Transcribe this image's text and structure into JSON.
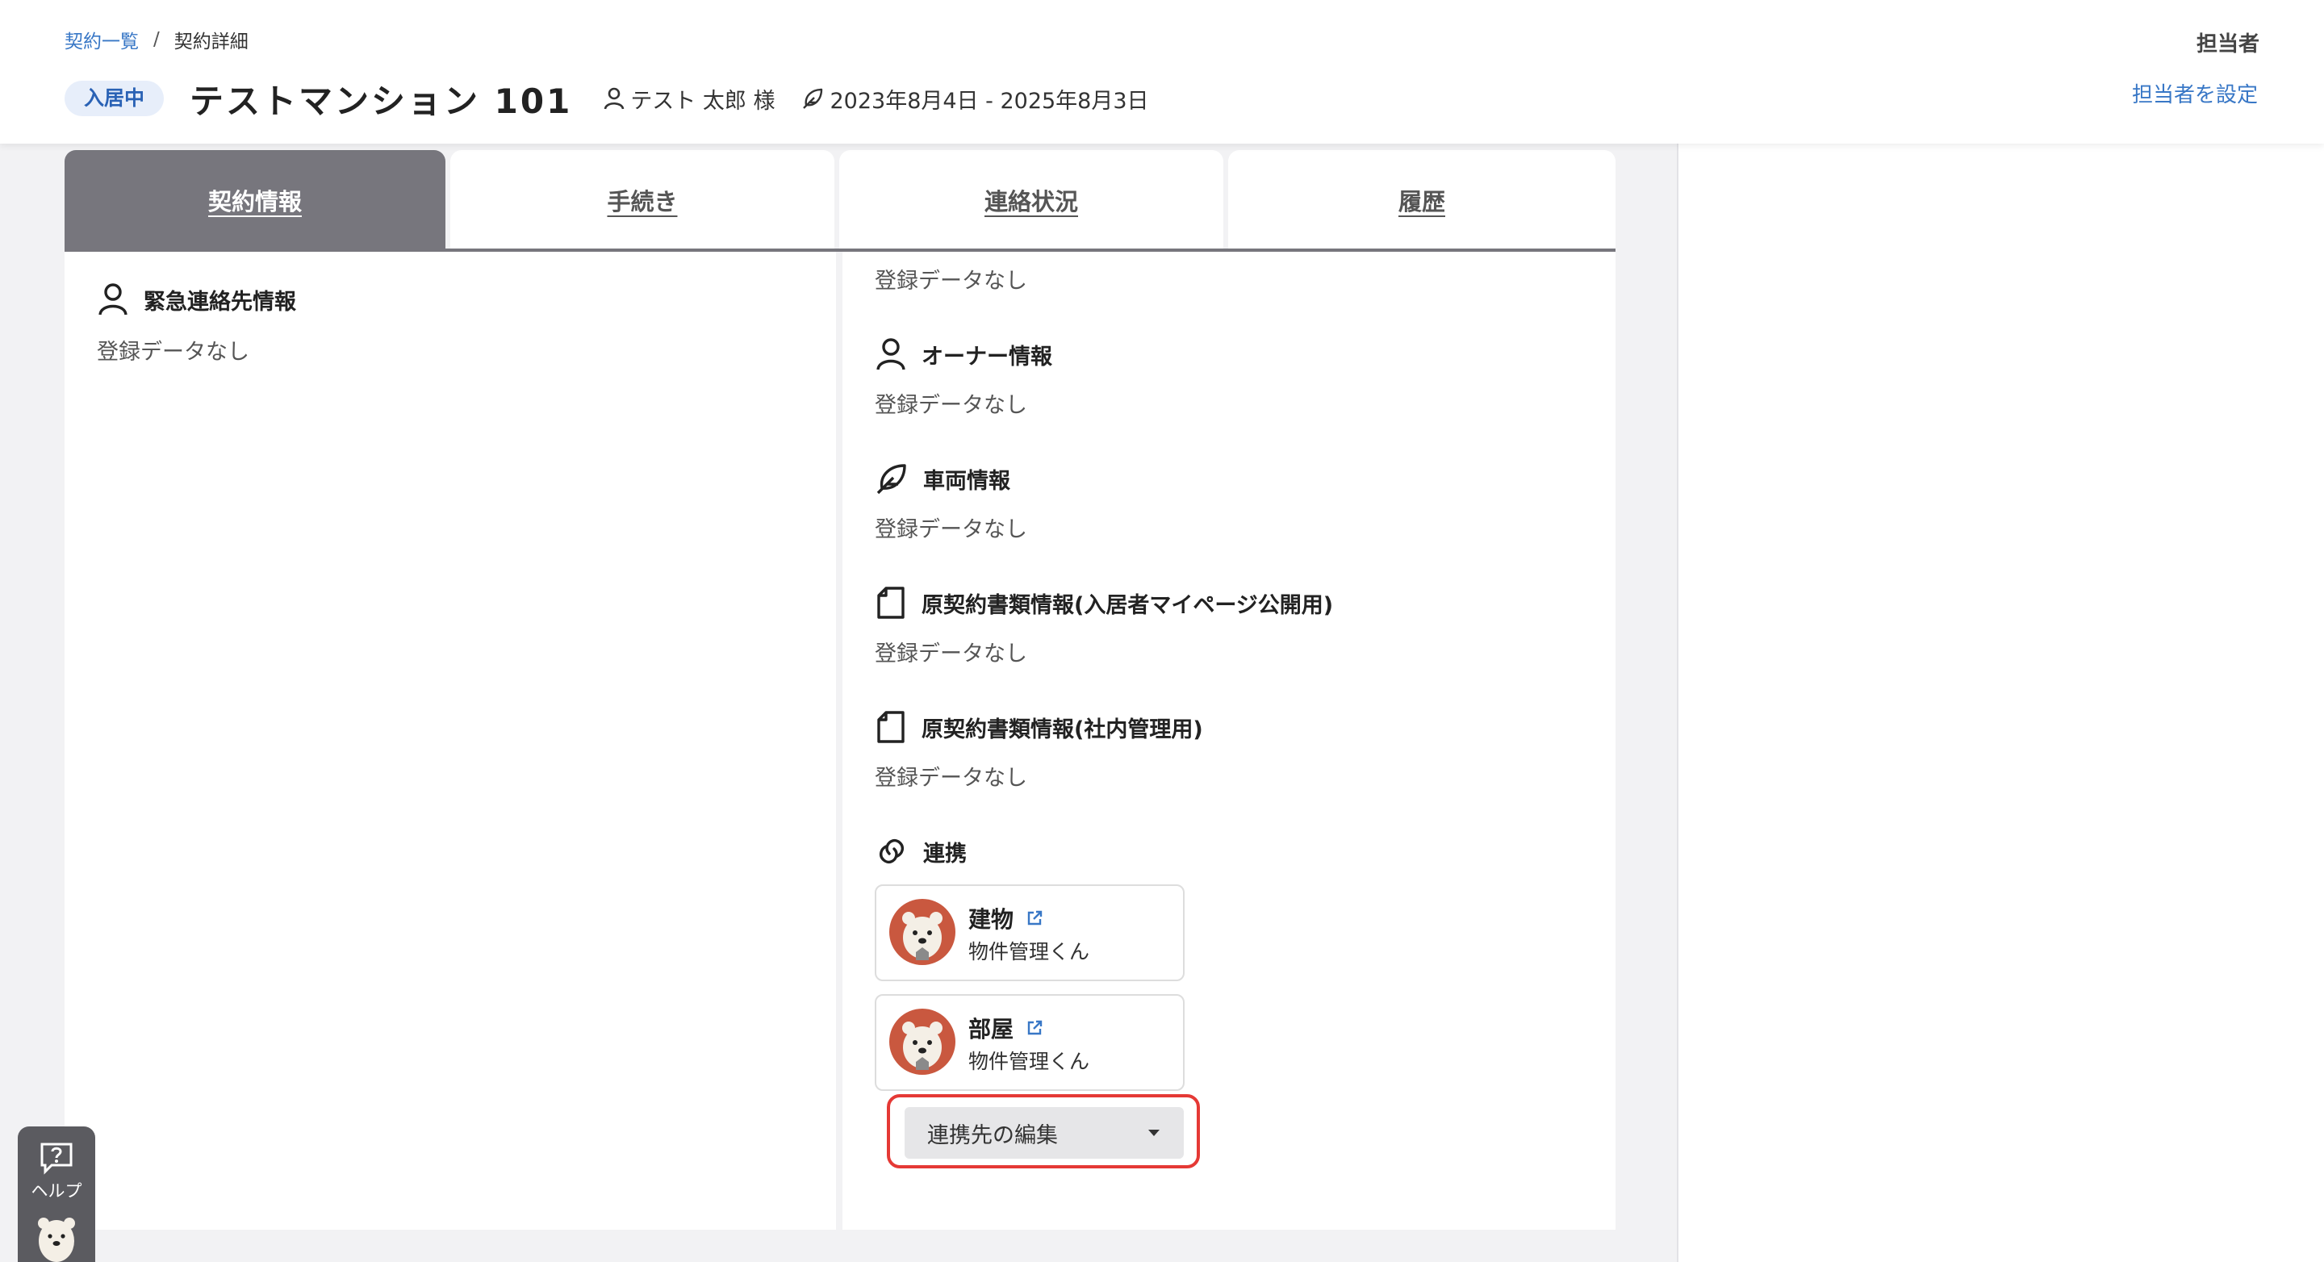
{
  "breadcrumb": {
    "list_link": "契約一覧",
    "separator": "/",
    "current": "契約詳細"
  },
  "header": {
    "status_badge": "入居中",
    "title": "テストマンション 101",
    "tenant": "テスト 太郎 様",
    "period": "2023年8月4日 - 2025年8月3日",
    "assignee_label": "担当者",
    "assignee_link": "担当者を設定"
  },
  "tabs": [
    {
      "label": "契約情報",
      "active": true
    },
    {
      "label": "手続き",
      "active": false
    },
    {
      "label": "連絡状況",
      "active": false
    },
    {
      "label": "履歴",
      "active": false
    }
  ],
  "left_column": {
    "emergency_contact": {
      "title": "緊急連絡先情報",
      "empty": "登録データなし"
    }
  },
  "right_column": {
    "top_empty": "登録データなし",
    "owner": {
      "title": "オーナー情報",
      "empty": "登録データなし"
    },
    "vehicle": {
      "title": "車両情報",
      "empty": "登録データなし"
    },
    "docs_public": {
      "title": "原契約書類情報(入居者マイページ公開用)",
      "empty": "登録データなし"
    },
    "docs_internal": {
      "title": "原契約書類情報(社内管理用)",
      "empty": "登録データなし"
    },
    "integration": {
      "title": "連携",
      "cards": [
        {
          "title": "建物",
          "subtitle": "物件管理くん"
        },
        {
          "title": "部屋",
          "subtitle": "物件管理くん"
        }
      ],
      "edit_button": "連携先の編集"
    }
  },
  "help": {
    "label": "ヘルプ"
  },
  "colors": {
    "accent": "#3877c6",
    "active_tab": "#77767d",
    "badge_bg": "#e7eefa",
    "highlight_border": "#e53935",
    "avatar": "#c9583f"
  }
}
